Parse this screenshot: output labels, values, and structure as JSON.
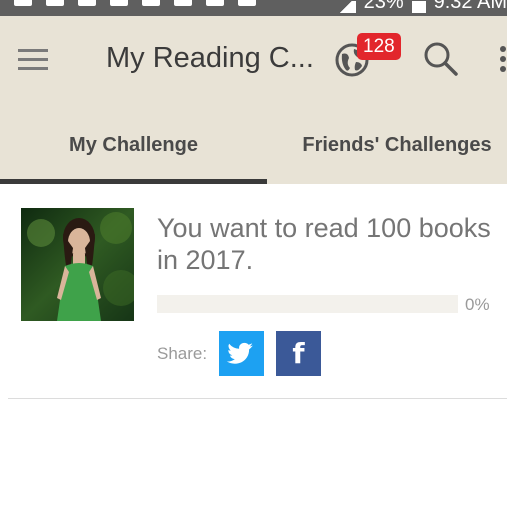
{
  "status_bar": {
    "battery_text": "23%",
    "time_text": "9:32 AM"
  },
  "app_bar": {
    "title": "My Reading C...",
    "notification_count": "128",
    "icons": [
      "menu-icon",
      "globe-icon",
      "search-icon",
      "more-vert-icon"
    ]
  },
  "tabs": [
    {
      "label": "My Challenge",
      "selected": true
    },
    {
      "label": "Friends' Challenges",
      "selected": false
    }
  ],
  "challenge": {
    "text": "You want to read 100 books in 2017.",
    "progress_fraction": 0,
    "progress_label": "0%",
    "share_label": "Share:",
    "share_buttons": [
      "twitter-icon",
      "facebook-icon"
    ],
    "facebook_glyph": "f"
  },
  "colors": {
    "app_bar_bg": "#e8e3d6",
    "badge_red": "#e2262c",
    "twitter_blue": "#1da1f2",
    "facebook_blue": "#3b5998",
    "tab_indicator": "#3a3a3a"
  }
}
